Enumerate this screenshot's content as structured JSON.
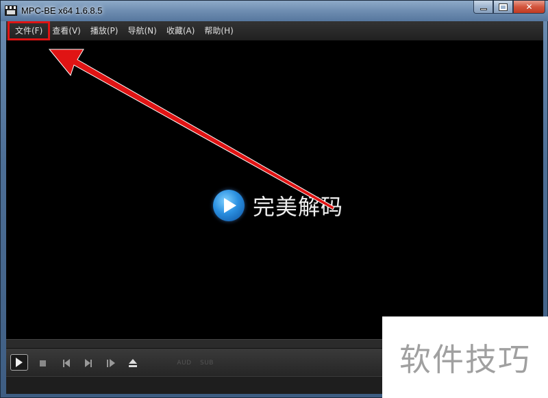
{
  "window": {
    "title": "MPC-BE x64 1.6.8.5",
    "controls": {
      "minimize": "",
      "maximize": "",
      "close": "✕"
    }
  },
  "menubar": {
    "items": [
      {
        "label": "文件(F)",
        "highlighted": true
      },
      {
        "label": "查看(V)"
      },
      {
        "label": "播放(P)"
      },
      {
        "label": "导航(N)"
      },
      {
        "label": "收藏(A)"
      },
      {
        "label": "帮助(H)"
      }
    ]
  },
  "video": {
    "logo_text": "完美解码"
  },
  "toolbar": {
    "audio_label": "AUD",
    "subtitle_label": "SUB"
  },
  "watermark": {
    "text": "软件技巧"
  },
  "annotation": {
    "color": "#e01414"
  }
}
